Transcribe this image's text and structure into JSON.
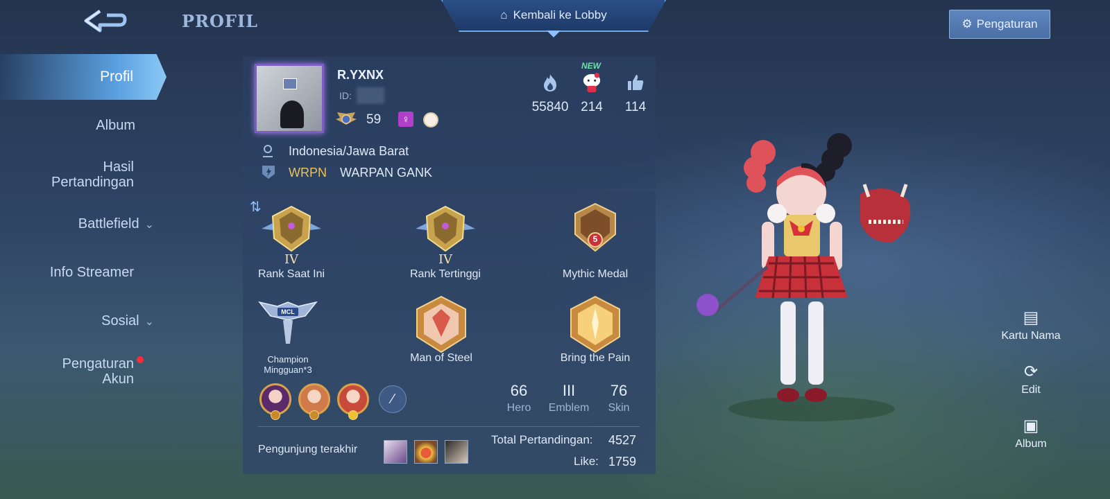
{
  "header": {
    "title": "PROFIL",
    "lobby_button": "Kembali ke Lobby",
    "settings_button": "Pengaturan"
  },
  "nav": {
    "active": "Profil",
    "items": [
      {
        "label": "Album"
      },
      {
        "label": "Hasil Pertandingan"
      },
      {
        "label": "Battlefield",
        "has_dropdown": true
      },
      {
        "label": "Info Streamer"
      },
      {
        "label": "Sosial",
        "has_dropdown": true
      },
      {
        "label": "Pengaturan Akun",
        "has_notification": true
      }
    ]
  },
  "profile": {
    "name": "R.YXNX",
    "id_label": "ID:",
    "level": "59",
    "gender_symbol": "♀",
    "stats": [
      {
        "icon": "flame-icon",
        "value": "55840"
      },
      {
        "icon": "hello-kitty-icon",
        "value": "214",
        "tag": "NEW"
      },
      {
        "icon": "thumbs-up-icon",
        "value": "114"
      }
    ],
    "location": "Indonesia/Jawa Barat",
    "squad_tag": "WRPN",
    "squad_name": "WARPAN GANK"
  },
  "achievements": {
    "current_rank_label": "Rank Saat Ini",
    "current_rank_tier": "IV",
    "highest_rank_label": "Rank Tertinggi",
    "highest_rank_tier": "IV",
    "mythic_medal_label": "Mythic Medal",
    "mythic_medal_number": "5",
    "champion_label": "Champion Mingguan*3",
    "champion_badge_text": "MCL",
    "steel_label": "Man of Steel",
    "pain_label": "Bring the Pain"
  },
  "counts": {
    "hero_value": "66",
    "hero_label": "Hero",
    "emblem_value": "III",
    "emblem_label": "Emblem",
    "skin_value": "76",
    "skin_label": "Skin"
  },
  "footer": {
    "visitors_label": "Pengunjung terakhir",
    "total_label": "Total Pertandingan:",
    "total_value": "4527",
    "like_label": "Like:",
    "like_value": "1759"
  },
  "side_actions": {
    "name_card": "Kartu Nama",
    "edit": "Edit",
    "album": "Album"
  },
  "colors": {
    "accent": "#5aa0e0",
    "squad_tag": "#e9c25a",
    "notification": "#ff2a3a",
    "gold": "#d9a24a"
  }
}
